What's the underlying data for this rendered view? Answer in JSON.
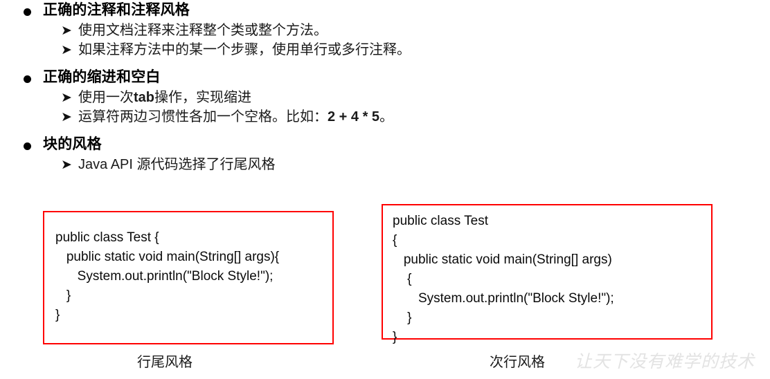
{
  "slide": {
    "sections": [
      {
        "heading": "正确的注释和注释风格",
        "items": [
          {
            "text": "使用文档注释来注释整个类或整个方法。"
          },
          {
            "text": "如果注释方法中的某一个步骤，使用单行或多行注释。"
          }
        ]
      },
      {
        "heading": "正确的缩进和空白",
        "items": [
          {
            "pre": "使用一次",
            "em": "tab",
            "post": "操作，实现缩进"
          },
          {
            "pre": "运算符两边习惯性各加一个空格。比如：",
            "em": "2 + 4 * 5",
            "post": "。"
          }
        ]
      },
      {
        "heading": "块的风格",
        "items": [
          {
            "text": "Java API 源代码选择了行尾风格"
          }
        ]
      }
    ],
    "markers": {
      "level1_bullet": "filled-circle-bullet",
      "level2_bullet": "arrow-bullet"
    }
  },
  "code_examples": {
    "left": {
      "name": "end-of-line-style",
      "code": "public class Test {\n   public static void main(String[] args){\n      System.out.println(\"Block Style!\");\n   }\n}",
      "caption": "行尾风格",
      "border_color": "#ff0000"
    },
    "right": {
      "name": "next-line-style",
      "code": "public class Test\n{\n   public static void main(String[] args)\n    {\n       System.out.println(\"Block Style!\");\n    }\n}",
      "caption": "次行风格",
      "border_color": "#ff0000"
    }
  },
  "watermark": {
    "text": "让天下没有难学的技术",
    "color": "#e3e3e3"
  }
}
